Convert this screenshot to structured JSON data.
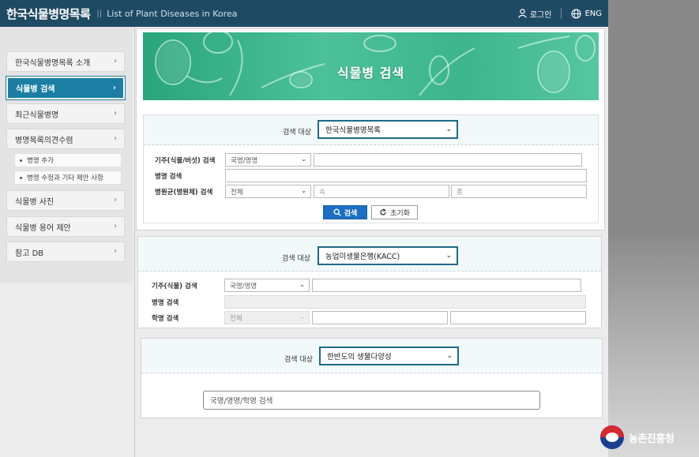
{
  "header": {
    "logo_kor": "한국식물병명목록",
    "logo_sep": "||",
    "logo_eng": "List of Plant Diseases in Korea",
    "login": "로그인",
    "lang": "ENG"
  },
  "sidebar": {
    "items": [
      {
        "label": "한국식물병명목록 소개"
      },
      {
        "label": "식물병 검색"
      },
      {
        "label": "최근식물병명"
      },
      {
        "label": "병명목록의견수렴"
      },
      {
        "label": "식물병 사진"
      },
      {
        "label": "식물병 용어 제안"
      },
      {
        "label": "참고 DB"
      }
    ],
    "subitems": [
      {
        "label": "병명 추가"
      },
      {
        "label": "병명 수정과 기타 제안 사항"
      }
    ]
  },
  "banner": {
    "title": "식물병 검색"
  },
  "search1": {
    "target_label": "검색 대상",
    "target_value": "한국식물병명목록",
    "host_label": "기주(식물/버섯) 검색",
    "host_select": "국명/영명",
    "disease_label": "병명 검색",
    "pathogen_label": "병원균(병원체) 검색",
    "pathogen_select": "전체",
    "genus_placeholder": "속",
    "species_placeholder": "종",
    "search_button": "검색",
    "reset_button": "초기화"
  },
  "search2": {
    "target_label": "검색 대상",
    "target_value": "농업미생물은행(KACC)",
    "host_label": "기주(식물) 검색",
    "host_select": "국명/영명",
    "disease_label": "병명 검색",
    "sci_label": "학명 검색",
    "sci_select": "전체"
  },
  "search3": {
    "target_label": "검색 대상",
    "target_value": "한반도의 생물다양성",
    "input_placeholder": "국명/영명/학명 검색"
  },
  "footer": {
    "org": "농촌진흥청"
  },
  "colors": {
    "header_bg": "#1f4a63",
    "active_menu": "#1d7ea3",
    "primary_button": "#1c6fc2",
    "select_border": "#1f6a86",
    "banner_green": "#3db58d"
  }
}
